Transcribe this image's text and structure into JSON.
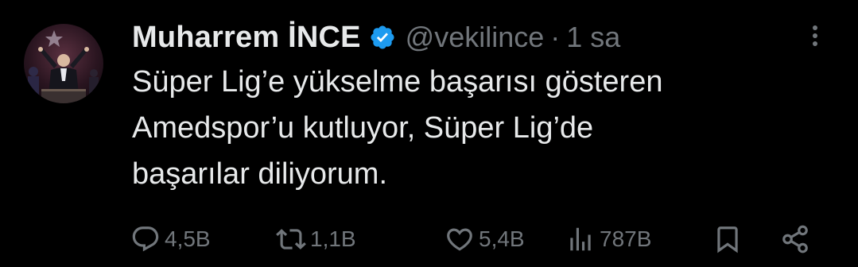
{
  "author": {
    "display_name": "Muharrem İNCE",
    "handle": "@vekilince",
    "separator": "·",
    "time": "1 sa"
  },
  "tweet": {
    "text": "Süper Lig’e yükselme başarısı gösteren\nAmedspor’u kutluyor, Süper Lig’de\nbaşarılar diliyorum."
  },
  "actions": {
    "replies": "4,5B",
    "retweets": "1,1B",
    "likes": "5,4B",
    "views": "787B"
  },
  "icons": {
    "verified": "verified-badge-icon",
    "more": "more-options-icon",
    "reply": "reply-icon",
    "retweet": "retweet-icon",
    "like": "heart-icon",
    "views": "views-chart-icon",
    "bookmark": "bookmark-icon",
    "share": "share-icon"
  },
  "colors": {
    "background": "#000000",
    "text": "#e7e9ea",
    "muted": "#71767b",
    "verified": "#1d9bf0"
  }
}
